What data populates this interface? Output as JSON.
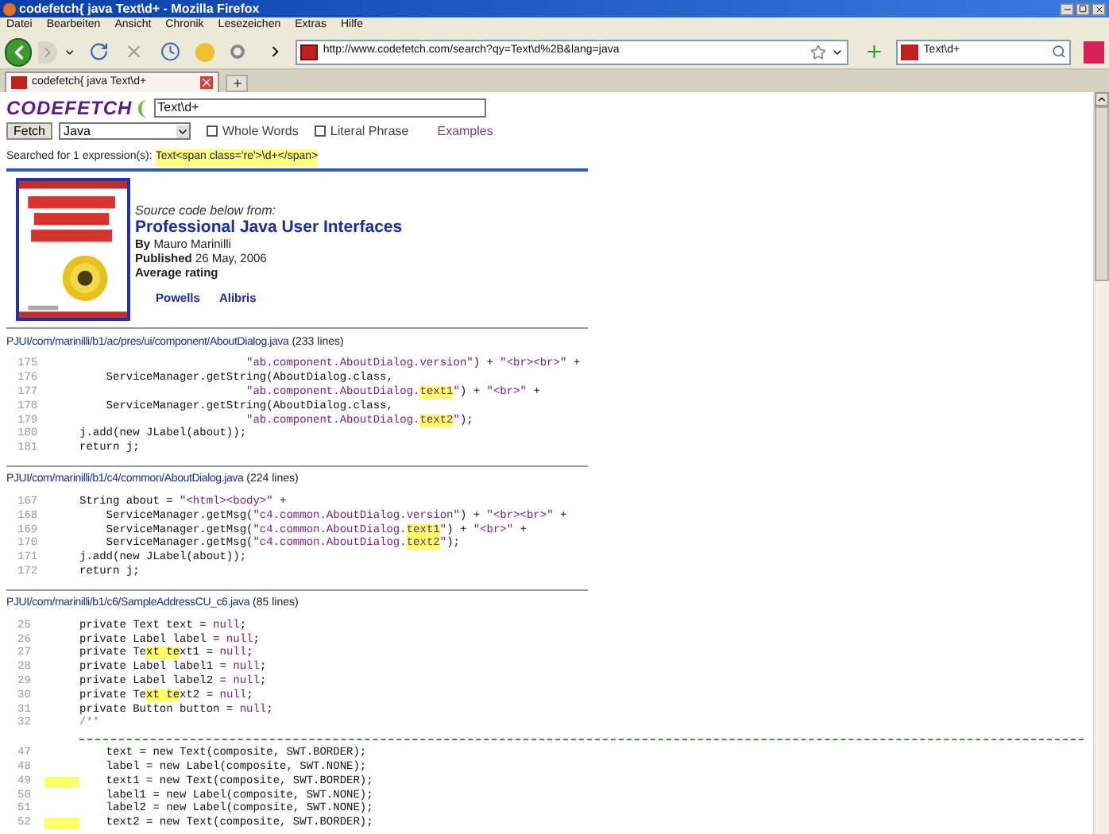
{
  "window": {
    "title": "codefetch{ java Text\\d+ - Mozilla Firefox"
  },
  "menu": [
    "Datei",
    "Bearbeiten",
    "Ansicht",
    "Chronik",
    "Lesezeichen",
    "Extras",
    "Hilfe"
  ],
  "address_bar": {
    "value": "http://www.codefetch.com/search?qy=Text\\d%2B&lang=java"
  },
  "search_bar": {
    "value": "Text\\d+"
  },
  "tabs": [
    {
      "label": "codefetch{ java Text\\d+",
      "selected": true
    }
  ],
  "page": {
    "logo": "CODEFETCH",
    "query": {
      "value": "Text\\d+"
    },
    "fetch_button": "Fetch",
    "language": "Java",
    "options": [
      {
        "label": "Whole Words",
        "checked": false
      },
      {
        "label": "Literal Phrase",
        "checked": false
      }
    ],
    "examples_link": "Examples",
    "summary": "Searched for 1 expression(s):",
    "expression": "Text<span class='re'>\\d+</span>",
    "book": {
      "intro": "Source code below from:",
      "title": "Professional Java User Interfaces",
      "author_label": "By",
      "author": "Mauro Marinilli",
      "published_label": "Published",
      "published": "26 May, 2006",
      "rating_label": "Average rating",
      "links": [
        "Powells",
        "Alibris"
      ]
    },
    "results": [
      {
        "path": "PJUI/com/marinilli/b1/ac/pres/ui/component/AboutDialog.java",
        "line_count": "(233 lines)",
        "lines": [
          {
            "kind": "code",
            "n": "175",
            "marked": false,
            "segments": [
              {
                "kind": "string",
                "text": "                         \"ab.component.AboutDialog.version\""
              },
              {
                "kind": "code",
                "text": ") + "
              },
              {
                "kind": "string",
                "text": "\"<br><br>\""
              },
              {
                "kind": "code",
                "text": " +"
              }
            ]
          },
          {
            "kind": "code",
            "n": "176",
            "marked": false,
            "segments": [
              {
                "kind": "code",
                "text": "    ServiceManager.getString(AboutDialog.class,"
              }
            ]
          },
          {
            "kind": "code",
            "n": "177",
            "marked": false,
            "segments": [
              {
                "kind": "string",
                "text": "                         \"ab.component.AboutDialog."
              },
              {
                "kind": "string-match",
                "text": "text1"
              },
              {
                "kind": "string",
                "text": "\""
              },
              {
                "kind": "code",
                "text": ") + "
              },
              {
                "kind": "string",
                "text": "\"<br>\""
              },
              {
                "kind": "code",
                "text": " +"
              }
            ]
          },
          {
            "kind": "code",
            "n": "178",
            "marked": false,
            "segments": [
              {
                "kind": "code",
                "text": "    ServiceManager.getString(AboutDialog.class,"
              }
            ]
          },
          {
            "kind": "code",
            "n": "179",
            "marked": false,
            "segments": [
              {
                "kind": "string",
                "text": "                         \"ab.component.AboutDialog."
              },
              {
                "kind": "string-match",
                "text": "text2"
              },
              {
                "kind": "string",
                "text": "\""
              },
              {
                "kind": "code",
                "text": ");"
              }
            ]
          },
          {
            "kind": "code",
            "n": "180",
            "marked": false,
            "segments": [
              {
                "kind": "code",
                "text": "j.add(new JLabel(about));"
              }
            ]
          },
          {
            "kind": "code",
            "n": "181",
            "marked": false,
            "segments": [
              {
                "kind": "code",
                "text": "return j;"
              }
            ]
          }
        ]
      },
      {
        "path": "PJUI/com/marinilli/b1/c4/common/AboutDialog.java",
        "line_count": "(224 lines)",
        "lines": [
          {
            "kind": "code",
            "n": "167",
            "marked": false,
            "segments": [
              {
                "kind": "code",
                "text": "String about = "
              },
              {
                "kind": "string",
                "text": "\"<html><body>\""
              },
              {
                "kind": "code",
                "text": " +"
              }
            ]
          },
          {
            "kind": "code",
            "n": "168",
            "marked": false,
            "segments": [
              {
                "kind": "code",
                "text": "    ServiceManager.getMsg("
              },
              {
                "kind": "string",
                "text": "\"c4.common.AboutDialog.version\""
              },
              {
                "kind": "code",
                "text": ") + "
              },
              {
                "kind": "string",
                "text": "\"<br><br>\""
              },
              {
                "kind": "code",
                "text": " +"
              }
            ]
          },
          {
            "kind": "code",
            "n": "169",
            "marked": false,
            "segments": [
              {
                "kind": "code",
                "text": "    ServiceManager.getMsg("
              },
              {
                "kind": "string",
                "text": "\"c4.common.AboutDialog."
              },
              {
                "kind": "string-match",
                "text": "text1"
              },
              {
                "kind": "string",
                "text": "\""
              },
              {
                "kind": "code",
                "text": ") + "
              },
              {
                "kind": "string",
                "text": "\"<br>\""
              },
              {
                "kind": "code",
                "text": " +"
              }
            ]
          },
          {
            "kind": "code",
            "n": "170",
            "marked": false,
            "segments": [
              {
                "kind": "code",
                "text": "    ServiceManager.getMsg("
              },
              {
                "kind": "string",
                "text": "\"c4.common.AboutDialog."
              },
              {
                "kind": "string-match",
                "text": "text2"
              },
              {
                "kind": "string",
                "text": "\""
              },
              {
                "kind": "code",
                "text": ");"
              }
            ]
          },
          {
            "kind": "code",
            "n": "171",
            "marked": false,
            "segments": [
              {
                "kind": "code",
                "text": "j.add(new JLabel(about));"
              }
            ]
          },
          {
            "kind": "code",
            "n": "172",
            "marked": false,
            "segments": [
              {
                "kind": "code",
                "text": "return j;"
              }
            ]
          }
        ]
      },
      {
        "path": "PJUI/com/marinilli/b1/c6/SampleAddressCU_c6.java",
        "line_count": "(85 lines)",
        "lines": [
          {
            "kind": "code",
            "n": "25",
            "marked": false,
            "segments": [
              {
                "kind": "code",
                "text": "private Text text = "
              },
              {
                "kind": "string",
                "text": "null"
              },
              {
                "kind": "code",
                "text": ";"
              }
            ]
          },
          {
            "kind": "code",
            "n": "26",
            "marked": false,
            "segments": [
              {
                "kind": "code",
                "text": "private Label label = "
              },
              {
                "kind": "string",
                "text": "null"
              },
              {
                "kind": "code",
                "text": ";"
              }
            ]
          },
          {
            "kind": "code",
            "n": "27",
            "marked": false,
            "segments": [
              {
                "kind": "code",
                "text": "private Te"
              },
              {
                "kind": "match",
                "text": "xt te"
              },
              {
                "kind": "code",
                "text": "xt1 = "
              },
              {
                "kind": "string",
                "text": "null"
              },
              {
                "kind": "code",
                "text": ";"
              }
            ]
          },
          {
            "kind": "code",
            "n": "28",
            "marked": false,
            "segments": [
              {
                "kind": "code",
                "text": "private Label label1 = "
              },
              {
                "kind": "string",
                "text": "null"
              },
              {
                "kind": "code",
                "text": ";"
              }
            ]
          },
          {
            "kind": "code",
            "n": "29",
            "marked": false,
            "segments": [
              {
                "kind": "code",
                "text": "private Label label2 = "
              },
              {
                "kind": "string",
                "text": "null"
              },
              {
                "kind": "code",
                "text": ";"
              }
            ]
          },
          {
            "kind": "code",
            "n": "30",
            "marked": false,
            "segments": [
              {
                "kind": "code",
                "text": "private Te"
              },
              {
                "kind": "match",
                "text": "xt te"
              },
              {
                "kind": "code",
                "text": "xt2 = "
              },
              {
                "kind": "string",
                "text": "null"
              },
              {
                "kind": "code",
                "text": ";"
              }
            ]
          },
          {
            "kind": "code",
            "n": "31",
            "marked": false,
            "segments": [
              {
                "kind": "code",
                "text": "private Button button = "
              },
              {
                "kind": "string",
                "text": "null"
              },
              {
                "kind": "code",
                "text": ";"
              }
            ]
          },
          {
            "kind": "code",
            "n": "32",
            "marked": false,
            "segments": [
              {
                "kind": "comment",
                "text": "/**"
              }
            ]
          },
          {
            "kind": "gap"
          },
          {
            "kind": "code",
            "n": "47",
            "marked": false,
            "segments": [
              {
                "kind": "code",
                "text": "    text = new Text(composite, SWT.BORDER);"
              }
            ]
          },
          {
            "kind": "code",
            "n": "48",
            "marked": false,
            "segments": [
              {
                "kind": "code",
                "text": "    label = new Label(composite, SWT.NONE);"
              }
            ]
          },
          {
            "kind": "code",
            "n": "49",
            "marked": true,
            "segments": [
              {
                "kind": "code",
                "text": "    text1 = new Text(composite, SWT.BORDER);"
              }
            ]
          },
          {
            "kind": "code",
            "n": "50",
            "marked": false,
            "segments": [
              {
                "kind": "code",
                "text": "    label1 = new Label(composite, SWT.NONE);"
              }
            ]
          },
          {
            "kind": "code",
            "n": "51",
            "marked": false,
            "segments": [
              {
                "kind": "code",
                "text": "    label2 = new Label(composite, SWT.NONE);"
              }
            ]
          },
          {
            "kind": "code",
            "n": "52",
            "marked": true,
            "segments": [
              {
                "kind": "code",
                "text": "    text2 = new Text(composite, SWT.BORDER);"
              }
            ]
          }
        ]
      }
    ]
  }
}
